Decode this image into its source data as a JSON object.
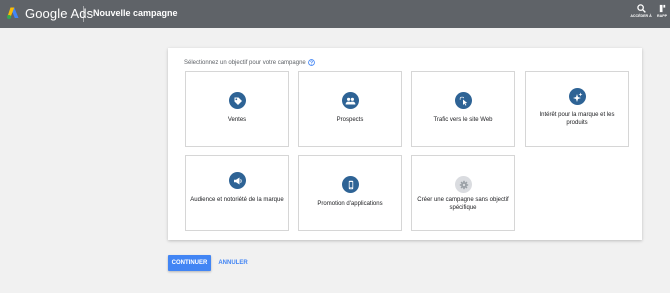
{
  "header": {
    "brand": "Google Ads",
    "title": "Nouvelle campagne",
    "tools": [
      {
        "icon": "search-icon",
        "label": "ACCÉDER À"
      },
      {
        "icon": "wrench-icon",
        "label": "RAPP"
      }
    ]
  },
  "prompt": {
    "text": "Sélectionnez un objectif pour votre campagne",
    "icon": "help-icon"
  },
  "objectives": [
    {
      "label": "Ventes",
      "icon": "tag-icon"
    },
    {
      "label": "Prospects",
      "icon": "people-icon"
    },
    {
      "label": "Trafic vers le site Web",
      "icon": "cursor-click-icon"
    },
    {
      "label": "Intérêt pour la marque et les produits",
      "icon": "sparkle-icon"
    },
    {
      "label": "Audience et notoriété de la marque",
      "icon": "megaphone-icon"
    },
    {
      "label": "Promotion d'applications",
      "icon": "phone-icon"
    },
    {
      "label": "Créer une campagne sans objectif spécifique",
      "icon": "gear-icon"
    }
  ],
  "actions": {
    "continue": "CONTINUER",
    "cancel": "ANNULER"
  },
  "colors": {
    "topbar": "#5f6368",
    "icon_bg": "#2e6395",
    "primary": "#4285f4"
  }
}
